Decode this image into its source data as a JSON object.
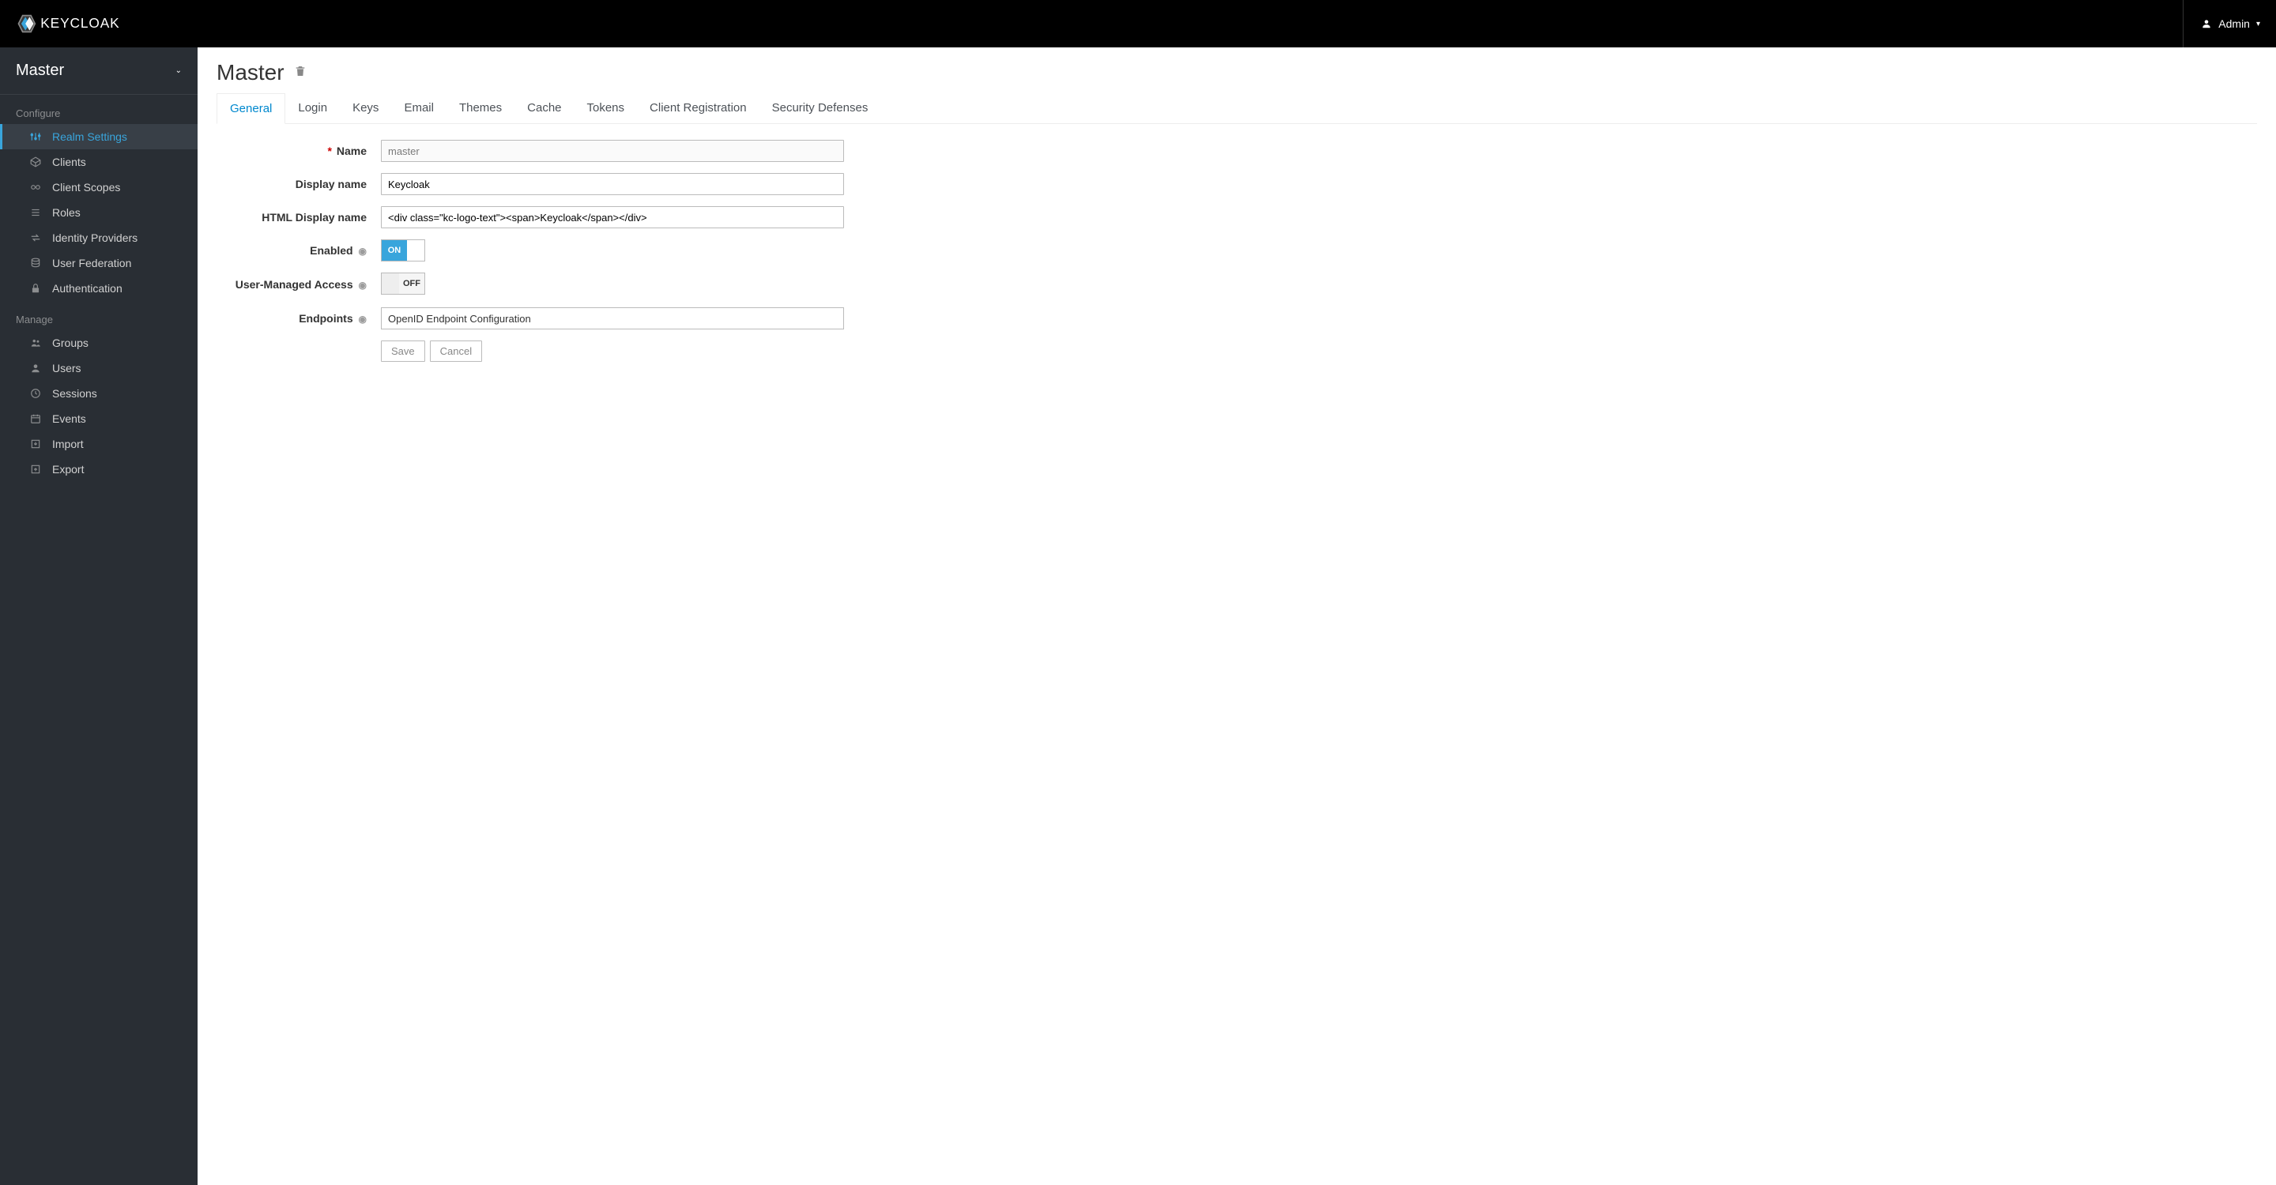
{
  "header": {
    "user_label": "Admin"
  },
  "sidebar": {
    "realm": "Master",
    "section_configure": "Configure",
    "section_manage": "Manage",
    "items_cfg": [
      {
        "label": "Realm Settings",
        "icon": "sliders"
      },
      {
        "label": "Clients",
        "icon": "cube"
      },
      {
        "label": "Client Scopes",
        "icon": "scope"
      },
      {
        "label": "Roles",
        "icon": "list"
      },
      {
        "label": "Identity Providers",
        "icon": "exchange"
      },
      {
        "label": "User Federation",
        "icon": "database"
      },
      {
        "label": "Authentication",
        "icon": "lock"
      }
    ],
    "items_mgr": [
      {
        "label": "Groups",
        "icon": "users"
      },
      {
        "label": "Users",
        "icon": "user"
      },
      {
        "label": "Sessions",
        "icon": "clock"
      },
      {
        "label": "Events",
        "icon": "calendar"
      },
      {
        "label": "Import",
        "icon": "import"
      },
      {
        "label": "Export",
        "icon": "export"
      }
    ]
  },
  "page": {
    "title": "Master"
  },
  "tabs": [
    {
      "label": "General"
    },
    {
      "label": "Login"
    },
    {
      "label": "Keys"
    },
    {
      "label": "Email"
    },
    {
      "label": "Themes"
    },
    {
      "label": "Cache"
    },
    {
      "label": "Tokens"
    },
    {
      "label": "Client Registration"
    },
    {
      "label": "Security Defenses"
    }
  ],
  "form": {
    "name_label": "Name",
    "name_value": "master",
    "display_name_label": "Display name",
    "display_name_value": "Keycloak",
    "html_display_name_label": "HTML Display name",
    "html_display_name_value": "<div class=\"kc-logo-text\"><span>Keycloak</span></div>",
    "enabled_label": "Enabled",
    "enabled_on": "ON",
    "uma_label": "User-Managed Access",
    "uma_off": "OFF",
    "endpoints_label": "Endpoints",
    "endpoints_value": "OpenID Endpoint Configuration",
    "save": "Save",
    "cancel": "Cancel"
  }
}
